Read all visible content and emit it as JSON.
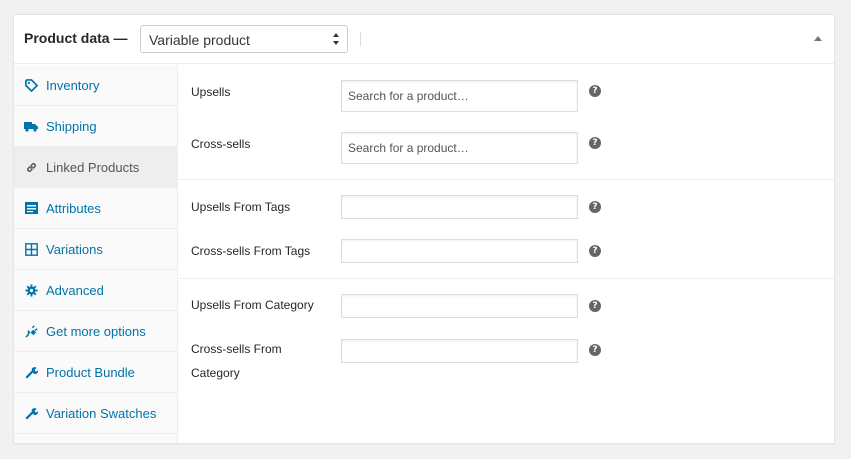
{
  "header": {
    "title": "Product data —",
    "product_type": "Variable product"
  },
  "colors": {
    "link": "#0073aa",
    "active_tab_bg": "#eeeeee",
    "help_icon": "#666666"
  },
  "tabs": [
    {
      "label": "Inventory",
      "icon": "tag-icon"
    },
    {
      "label": "Shipping",
      "icon": "truck-icon"
    },
    {
      "label": "Linked Products",
      "icon": "link-icon",
      "active": true
    },
    {
      "label": "Attributes",
      "icon": "list-icon"
    },
    {
      "label": "Variations",
      "icon": "grid-icon"
    },
    {
      "label": "Advanced",
      "icon": "gear-icon"
    },
    {
      "label": "Get more options",
      "icon": "plugin-icon"
    },
    {
      "label": "Product Bundle",
      "icon": "wrench-icon"
    },
    {
      "label": "Variation Swatches",
      "icon": "wrench-icon"
    }
  ],
  "fields": {
    "upsells": {
      "label": "Upsells",
      "placeholder": "Search for a product…"
    },
    "crosssells": {
      "label": "Cross-sells",
      "placeholder": "Search for a product…"
    },
    "upsells_tags": {
      "label": "Upsells From Tags",
      "value": ""
    },
    "crosssells_tags": {
      "label": "Cross-sells From Tags",
      "value": ""
    },
    "upsells_category": {
      "label": "Upsells From Category",
      "value": ""
    },
    "crosssells_category": {
      "label": "Cross-sells From Category",
      "value": ""
    }
  }
}
